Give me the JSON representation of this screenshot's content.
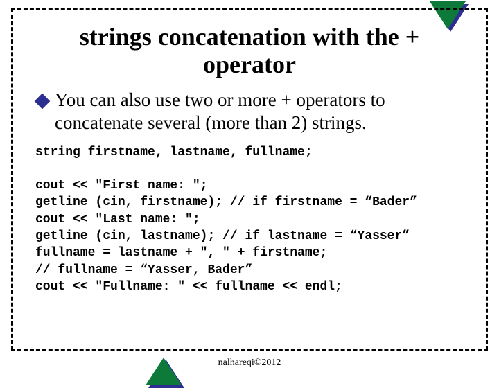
{
  "title": "strings concatenation with the + operator",
  "bullet": "You can also use two or more + operators to concatenate several (more than 2) strings.",
  "code": "string firstname, lastname, fullname;\n\ncout << \"First name: \";\ngetline (cin, firstname); // if firstname = “Bader”\ncout << \"Last name: \";\ngetline (cin, lastname); // if lastname = “Yasser”\nfullname = lastname + \", \" + firstname;\n// fullname = “Yasser, Bader”\ncout << \"Fullname: \" << fullname << endl;",
  "footer": "nalhareqi©2012"
}
